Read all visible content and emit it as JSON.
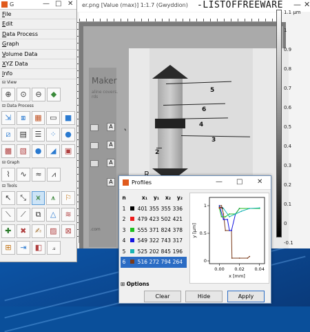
{
  "toolbox": {
    "title": "G",
    "menu": [
      "File",
      "Edit",
      "Data Process",
      "Graph",
      "Volume Data",
      "XYZ Data",
      "Info"
    ],
    "sections": {
      "view": "View",
      "data_process": "Data Process",
      "graph": "Graph",
      "tools": "Tools"
    },
    "window_controls": [
      "—",
      "□",
      "✕"
    ]
  },
  "image_window": {
    "title": "er.png [Value (max)] 1:1.7 (Gwyddion)",
    "watermark": "-LISTOFFREEWARE",
    "window_controls": [
      "—",
      "✕"
    ],
    "maker_title": "Maker",
    "maker_subtitle": "aline covers. rds",
    "maker_footer": ".com",
    "maker_buttons": [
      "A",
      "A",
      "A",
      "A"
    ],
    "profile_labels": [
      "5",
      "6",
      "4",
      "3",
      "2"
    ],
    "bottom_text": "R...",
    "colorbar_top": "1.1 µm",
    "colorbar_labels": [
      "1",
      "0.9",
      "0.8",
      "0.7",
      "0.6",
      "0.5",
      "0.4",
      "0.3",
      "0.2",
      "0.1",
      "0",
      "-0.1"
    ]
  },
  "profiles": {
    "title": "Profiles",
    "window_controls": [
      "—",
      "□",
      "✕"
    ],
    "headers": [
      "n",
      "x₁",
      "y₁",
      "x₂",
      "y₂"
    ],
    "rows": [
      {
        "n": "1",
        "color": "#000000",
        "x1": "401",
        "y1": "355",
        "x2": "355",
        "y2": "336"
      },
      {
        "n": "2",
        "color": "#ee1c1c",
        "x1": "479",
        "y1": "423",
        "x2": "502",
        "y2": "421"
      },
      {
        "n": "3",
        "color": "#1fbe1f",
        "x1": "555",
        "y1": "371",
        "x2": "824",
        "y2": "378"
      },
      {
        "n": "4",
        "color": "#1515e0",
        "x1": "549",
        "y1": "322",
        "x2": "743",
        "y2": "317"
      },
      {
        "n": "5",
        "color": "#19b4b4",
        "x1": "525",
        "y1": "202",
        "x2": "845",
        "y2": "196"
      },
      {
        "n": "6",
        "color": "#7a3a1a",
        "x1": "516",
        "y1": "272",
        "x2": "794",
        "y2": "264"
      }
    ],
    "options_label": "Options",
    "buttons": {
      "clear": "Clear",
      "hide": "Hide",
      "apply": "Apply"
    }
  },
  "chart_data": {
    "type": "line",
    "xlabel": "x [mm]",
    "ylabel": "y [µm]",
    "xlim": [
      -0.01,
      0.045
    ],
    "ylim": [
      -0.05,
      1.15
    ],
    "xticks": [
      "0.00",
      "0.02",
      "0.04"
    ],
    "yticks": [
      "0",
      "0.5",
      "1"
    ],
    "series": [
      {
        "color": "#7a3a1a",
        "x": [
          0,
          0.002,
          0.004,
          0.006,
          0.012,
          0.0125,
          0.02,
          0.028,
          0.03
        ],
        "y": [
          1.0,
          1.0,
          0.85,
          0.55,
          0.55,
          0.05,
          0.05,
          0.05,
          0.08
        ]
      },
      {
        "color": "#1515e0",
        "x": [
          0,
          0.004,
          0.008,
          0.01,
          0.012,
          0.016,
          0.02
        ],
        "y": [
          1.0,
          0.75,
          0.75,
          0.55,
          0.55,
          0.85,
          0.95
        ]
      },
      {
        "color": "#1fbe1f",
        "x": [
          0,
          0.002,
          0.006,
          0.01,
          0.016,
          0.02,
          0.04
        ],
        "y": [
          0.95,
          0.8,
          0.8,
          0.85,
          0.85,
          0.95,
          0.95
        ]
      },
      {
        "color": "#19b4b4",
        "x": [
          0,
          0.004,
          0.01,
          0.016,
          0.022,
          0.03,
          0.04
        ],
        "y": [
          0.98,
          0.95,
          0.8,
          0.85,
          0.9,
          0.95,
          0.96
        ]
      },
      {
        "color": "#000000",
        "x": [
          0,
          0.003
        ],
        "y": [
          0.97,
          0.96
        ]
      },
      {
        "color": "#ee1c1c",
        "x": [
          0,
          0.001
        ],
        "y": [
          0.96,
          0.96
        ]
      }
    ]
  }
}
